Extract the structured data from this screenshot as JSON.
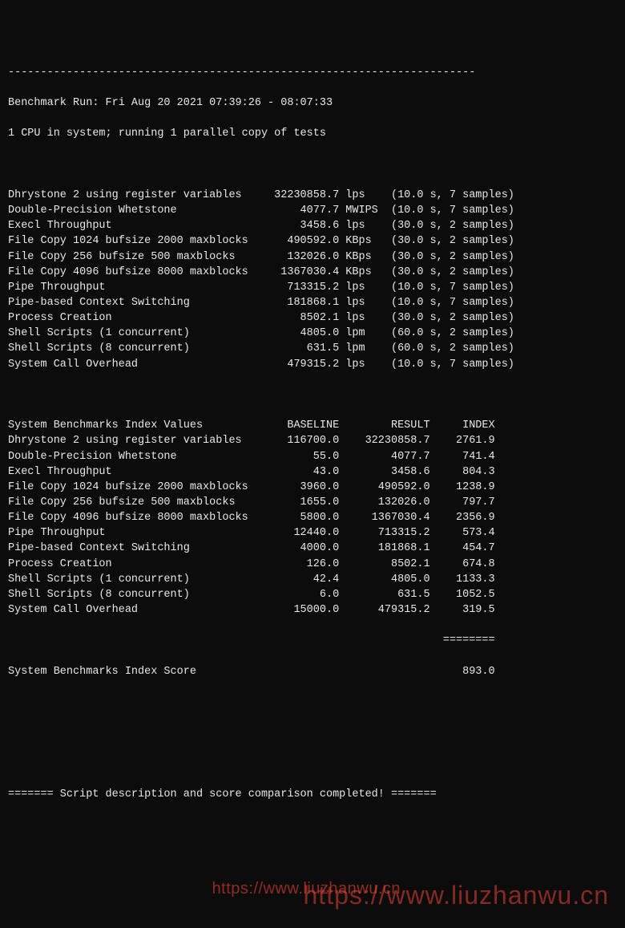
{
  "divider_top": "------------------------------------------------------------------------",
  "run_header": "Benchmark Run: Fri Aug 20 2021 07:39:26 - 08:07:33",
  "cpu_line": "1 CPU in system; running 1 parallel copy of tests",
  "tests": [
    {
      "name": "Dhrystone 2 using register variables",
      "value": "32230858.7",
      "unit": "lps",
      "timing": "(10.0 s, 7 samples)"
    },
    {
      "name": "Double-Precision Whetstone",
      "value": "4077.7",
      "unit": "MWIPS",
      "timing": "(10.0 s, 7 samples)"
    },
    {
      "name": "Execl Throughput",
      "value": "3458.6",
      "unit": "lps",
      "timing": "(30.0 s, 2 samples)"
    },
    {
      "name": "File Copy 1024 bufsize 2000 maxblocks",
      "value": "490592.0",
      "unit": "KBps",
      "timing": "(30.0 s, 2 samples)"
    },
    {
      "name": "File Copy 256 bufsize 500 maxblocks",
      "value": "132026.0",
      "unit": "KBps",
      "timing": "(30.0 s, 2 samples)"
    },
    {
      "name": "File Copy 4096 bufsize 8000 maxblocks",
      "value": "1367030.4",
      "unit": "KBps",
      "timing": "(30.0 s, 2 samples)"
    },
    {
      "name": "Pipe Throughput",
      "value": "713315.2",
      "unit": "lps",
      "timing": "(10.0 s, 7 samples)"
    },
    {
      "name": "Pipe-based Context Switching",
      "value": "181868.1",
      "unit": "lps",
      "timing": "(10.0 s, 7 samples)"
    },
    {
      "name": "Process Creation",
      "value": "8502.1",
      "unit": "lps",
      "timing": "(30.0 s, 2 samples)"
    },
    {
      "name": "Shell Scripts (1 concurrent)",
      "value": "4805.0",
      "unit": "lpm",
      "timing": "(60.0 s, 2 samples)"
    },
    {
      "name": "Shell Scripts (8 concurrent)",
      "value": "631.5",
      "unit": "lpm",
      "timing": "(60.0 s, 2 samples)"
    },
    {
      "name": "System Call Overhead",
      "value": "479315.2",
      "unit": "lps",
      "timing": "(10.0 s, 7 samples)"
    }
  ],
  "index_header": {
    "label": "System Benchmarks Index Values",
    "c1": "BASELINE",
    "c2": "RESULT",
    "c3": "INDEX"
  },
  "index_rows": [
    {
      "name": "Dhrystone 2 using register variables",
      "baseline": "116700.0",
      "result": "32230858.7",
      "index": "2761.9"
    },
    {
      "name": "Double-Precision Whetstone",
      "baseline": "55.0",
      "result": "4077.7",
      "index": "741.4"
    },
    {
      "name": "Execl Throughput",
      "baseline": "43.0",
      "result": "3458.6",
      "index": "804.3"
    },
    {
      "name": "File Copy 1024 bufsize 2000 maxblocks",
      "baseline": "3960.0",
      "result": "490592.0",
      "index": "1238.9"
    },
    {
      "name": "File Copy 256 bufsize 500 maxblocks",
      "baseline": "1655.0",
      "result": "132026.0",
      "index": "797.7"
    },
    {
      "name": "File Copy 4096 bufsize 8000 maxblocks",
      "baseline": "5800.0",
      "result": "1367030.4",
      "index": "2356.9"
    },
    {
      "name": "Pipe Throughput",
      "baseline": "12440.0",
      "result": "713315.2",
      "index": "573.4"
    },
    {
      "name": "Pipe-based Context Switching",
      "baseline": "4000.0",
      "result": "181868.1",
      "index": "454.7"
    },
    {
      "name": "Process Creation",
      "baseline": "126.0",
      "result": "8502.1",
      "index": "674.8"
    },
    {
      "name": "Shell Scripts (1 concurrent)",
      "baseline": "42.4",
      "result": "4805.0",
      "index": "1133.3"
    },
    {
      "name": "Shell Scripts (8 concurrent)",
      "baseline": "6.0",
      "result": "631.5",
      "index": "1052.5"
    },
    {
      "name": "System Call Overhead",
      "baseline": "15000.0",
      "result": "479315.2",
      "index": "319.5"
    }
  ],
  "score_divider": "                                                                   ========",
  "score_line": {
    "label": "System Benchmarks Index Score",
    "value": "893.0"
  },
  "footer": "======= Script description and score comparison completed! =======",
  "watermark1": "https://www.liuzhanwu.cn",
  "watermark2": "https://www.liuzhanwu.cn"
}
